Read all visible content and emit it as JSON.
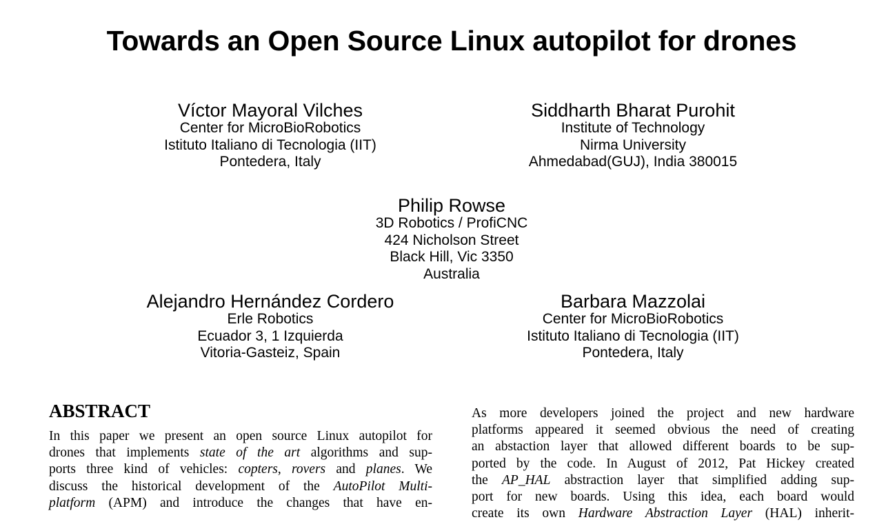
{
  "paper": {
    "title": "Towards an Open Source Linux autopilot for drones",
    "authors": [
      {
        "name": "Víctor Mayoral Vilches",
        "lines": [
          "Center for MicroBioRobotics",
          "Istituto Italiano di Tecnologia (IIT)",
          "Pontedera, Italy"
        ]
      },
      {
        "name": "Siddharth Bharat Purohit",
        "lines": [
          "Institute of Technology",
          "Nirma University",
          "Ahmedabad(GUJ), India 380015"
        ]
      },
      {
        "name": "Philip Rowse",
        "lines": [
          "3D Robotics / ProfiCNC",
          "424 Nicholson Street",
          "Black Hill, Vic 3350",
          "Australia"
        ]
      },
      {
        "name": "Alejandro Hernández Cordero",
        "lines": [
          "Erle Robotics",
          "Ecuador 3, 1 Izquierda",
          "Vitoria-Gasteiz, Spain"
        ]
      },
      {
        "name": "Barbara Mazzolai",
        "lines": [
          "Center for MicroBioRobotics",
          "Istituto Italiano di Tecnologia (IIT)",
          "Pontedera, Italy"
        ]
      }
    ],
    "abstract_heading": "ABSTRACT",
    "abstract_lines": [
      [
        "In this paper we present an open source Linux autopilot for"
      ],
      [
        "drones that implements ",
        {
          "i": "state of the art"
        },
        " algorithms and sup-"
      ],
      [
        "ports three kind of vehicles: ",
        {
          "i": "copters"
        },
        ", ",
        {
          "i": "rovers"
        },
        " and ",
        {
          "i": "planes"
        },
        ". We"
      ],
      [
        "discuss the historical development of the ",
        {
          "i": "AutoPilot Multi-"
        }
      ],
      [
        {
          "i": "platform"
        },
        " (APM) and introduce the changes that have en-"
      ]
    ],
    "right_column_lines": [
      [
        "As more developers joined the project and new hardware"
      ],
      [
        "platforms appeared it seemed obvious the need of creating"
      ],
      [
        "an abstaction layer that allowed different boards to be sup-"
      ],
      [
        "ported by the code. In August of 2012, Pat Hickey created"
      ],
      [
        "the ",
        {
          "i": "AP_HAL"
        },
        " abstraction layer that simplified adding sup-"
      ],
      [
        "port for new boards.  Using this idea, each board would"
      ],
      [
        "create its own ",
        {
          "i": "Hardware Abstraction Layer"
        },
        " (HAL) inherit-"
      ]
    ]
  }
}
